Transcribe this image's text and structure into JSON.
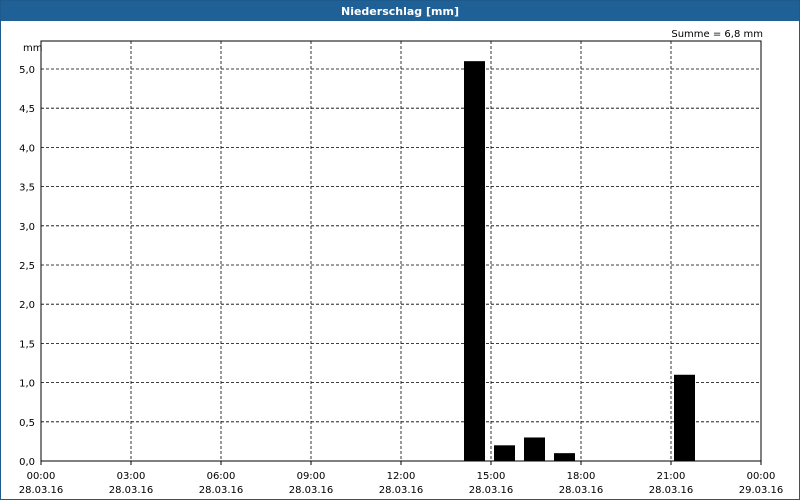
{
  "window": {
    "title": "Niederschlag [mm]"
  },
  "chart_data": {
    "type": "bar",
    "title": "Niederschlag [mm]",
    "ylabel": "mm",
    "annotation": "Summe = 6,8 mm",
    "ylim": [
      0,
      5.0
    ],
    "yticks": [
      "0,0",
      "0,5",
      "1,0",
      "1,5",
      "2,0",
      "2,5",
      "3,0",
      "3,5",
      "4,0",
      "4,5",
      "5,0"
    ],
    "xlim_hours": [
      0,
      24
    ],
    "xticks": [
      {
        "time": "00:00",
        "date": "28.03.16"
      },
      {
        "time": "03:00",
        "date": "28.03.16"
      },
      {
        "time": "06:00",
        "date": "28.03.16"
      },
      {
        "time": "09:00",
        "date": "28.03.16"
      },
      {
        "time": "12:00",
        "date": "28.03.16"
      },
      {
        "time": "15:00",
        "date": "28.03.16"
      },
      {
        "time": "18:00",
        "date": "28.03.16"
      },
      {
        "time": "21:00",
        "date": "28.03.16"
      },
      {
        "time": "00:00",
        "date": "29.03.16"
      }
    ],
    "bars": [
      {
        "hour": 14,
        "value": 5.1
      },
      {
        "hour": 15,
        "value": 0.2
      },
      {
        "hour": 16,
        "value": 0.3
      },
      {
        "hour": 17,
        "value": 0.1
      },
      {
        "hour": 21,
        "value": 1.1
      }
    ],
    "grid": true,
    "bar_color": "#000000"
  }
}
